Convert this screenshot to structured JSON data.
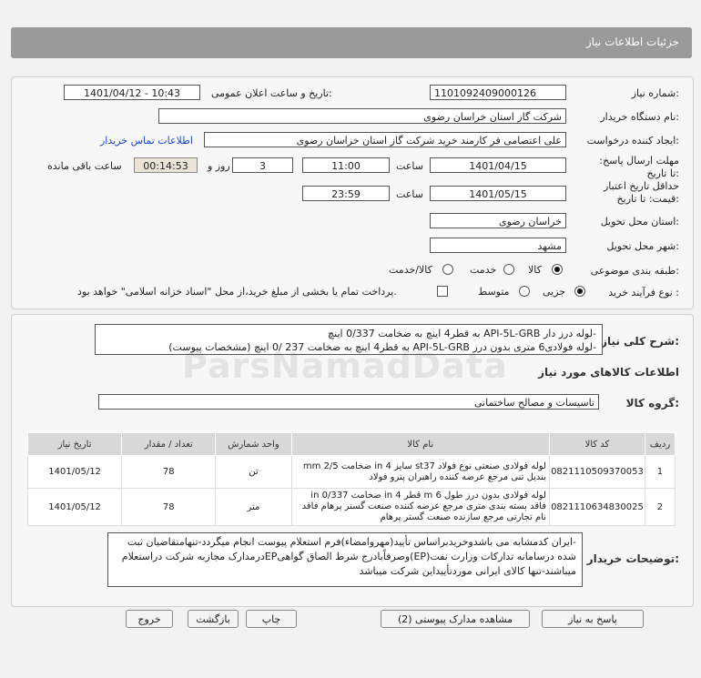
{
  "page_title": "جزئیات اطلاعات نیاز",
  "fields": {
    "need_number_label": "شماره نیاز:",
    "need_number": "1101092409000126",
    "announce_label": "تاریخ و ساعت اعلان عمومی:",
    "announce_value": "1401/04/12 - 10:43",
    "buyer_org_label": "نام دستگاه خریدار:",
    "buyer_org": "شرکت گاز استان خراسان رضوی",
    "requester_label": "ایجاد کننده درخواست:",
    "requester": "علی اعتصامی فر کارمند خرید شرکت گاز استان خراسان رضوی",
    "contact_link": "اطلاعات تماس خریدار",
    "deadline_label": "مهلت ارسال پاسخ: تا تاریخ:",
    "deadline_date": "1401/04/15",
    "time_label": "ساعت",
    "deadline_time": "11:00",
    "days_value": "3",
    "days_label": "روز و",
    "remaining_value": "00:14:53",
    "remaining_label": "ساعت باقی مانده",
    "validity_label": "حداقل تاریخ اعتبار قیمت: تا تاریخ:",
    "validity_date": "1401/05/15",
    "validity_time": "23:59",
    "province_label": "استان محل تحویل:",
    "province": "خراسان رضوی",
    "city_label": "شهر محل تحویل:",
    "city": "مشهد",
    "category_label": "طبقه بندی موضوعی:",
    "category_options": [
      "کالا",
      "خدمت",
      "کالا/خدمت"
    ],
    "process_label": "نوع فرآیند خرید :",
    "process_options": [
      "جزیی",
      "متوسط"
    ],
    "payment_note": "پرداخت تمام یا بخشی از مبلغ خرید،از محل \"اسناد خزانه اسلامی\" خواهد بود."
  },
  "summary": {
    "label": "شرح کلی نیاز:",
    "line1": "-لوله درز دار API-5L-GRB به قطر4 اینچ  به ضخامت 0/337  اینچ",
    "line2": "-لوله فولادی6 متری بدون درز API-5L-GRB به قطر4 اینچ  به ضخامت 237 /0 اینچ (مشخصات پیوست)"
  },
  "goods_info_title": "اطلاعات کالاهای مورد نیاز",
  "goods_group_label": "گروه کالا:",
  "goods_group": "تاسیسات و مصالح ساختمانی",
  "table": {
    "headers": [
      "ردیف",
      "کد کالا",
      "نام کالا",
      "واحد شمارش",
      "تعداد / مقدار",
      "تاریخ نیاز"
    ],
    "rows": [
      {
        "row": "1",
        "code": "0821110509370053",
        "name": "لوله فولادی صنعتی نوع فولاد st37 سایز 4 in ضخامت 2/5 mm بندیل تنی مرجع عرضه کننده راهبران پترو فولاد",
        "unit": "تن",
        "qty": "78",
        "date": "1401/05/12"
      },
      {
        "row": "2",
        "code": "0821110634830025",
        "name": "لوله فولادی بدون درز طول 6 m قطر 4 in ضخامت 0/337 in فاقد بسته بندی متری مرجع عرضه کننده صنعت گستر پرهام فاقد نام تجارتی مرجع سازنده صنعت گستر پرهام",
        "unit": "متر",
        "qty": "78",
        "date": "1401/05/12"
      }
    ]
  },
  "buyer_notes_label": "توضیحات خریدار:",
  "buyer_notes": "-ایران کدمشابه می باشدوخریدبراساس تأیید(مهروامضاء)فرم استعلام پیوست انجام میگردد-تنهامتقاضیان ثبت شده درسامانه تدارکات وزارت نفت(EP)وصرفاًبادرج شرط الصاق گواهیEPدرمدارک مجازبه شرکت دراستعلام میباشند-تنها کالای ایرانی موردتأییداین شرکت میباشد",
  "buttons": {
    "reply": "پاسخ به نیاز",
    "attachments": "مشاهده مدارک پیوستی (2)",
    "print": "چاپ",
    "back": "بازگشت",
    "exit": "خروج"
  },
  "watermark": "ParsNamadData"
}
